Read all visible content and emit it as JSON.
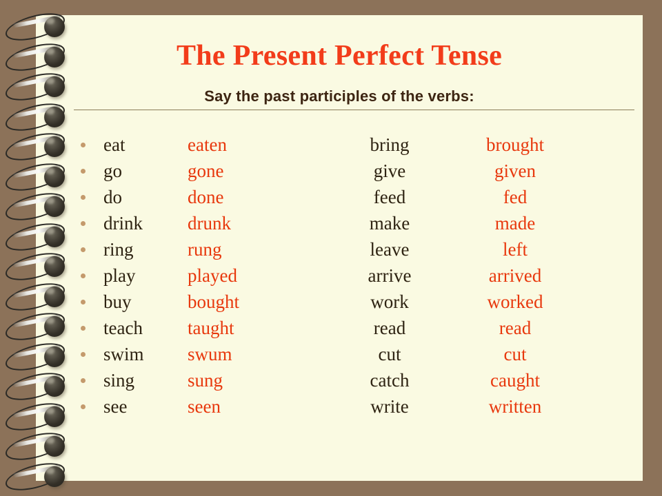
{
  "slide": {
    "title": "The Present Perfect Tense",
    "subtitle": "Say the past participles of the verbs:",
    "colors": {
      "background": "#8C7259",
      "paper": "#FAFAE2",
      "title": "#F23C1A",
      "subtitle": "#3D2512",
      "base_verb": "#2E2312",
      "participle": "#E8380D",
      "bullet": "#C49A6C",
      "rule": "#8A7D58"
    }
  },
  "verb_rows": [
    {
      "base_left": "eat",
      "participle_left": "eaten",
      "base_right": "bring",
      "participle_right": "brought"
    },
    {
      "base_left": "go",
      "participle_left": "gone",
      "base_right": "give",
      "participle_right": "given"
    },
    {
      "base_left": "do",
      "participle_left": "done",
      "base_right": "feed",
      "participle_right": "fed"
    },
    {
      "base_left": "drink",
      "participle_left": "drunk",
      "base_right": "make",
      "participle_right": "made"
    },
    {
      "base_left": "ring",
      "participle_left": "rung",
      "base_right": "leave",
      "participle_right": "left"
    },
    {
      "base_left": "play",
      "participle_left": "played",
      "base_right": "arrive",
      "participle_right": "arrived"
    },
    {
      "base_left": "buy",
      "participle_left": "bought",
      "base_right": "work",
      "participle_right": "worked"
    },
    {
      "base_left": "teach",
      "participle_left": "taught",
      "base_right": "read",
      "participle_right": "read"
    },
    {
      "base_left": "swim",
      "participle_left": "swum",
      "base_right": "cut",
      "participle_right": "cut"
    },
    {
      "base_left": "sing",
      "participle_left": "sung",
      "base_right": "catch",
      "participle_right": "caught"
    },
    {
      "base_left": "see",
      "participle_left": "seen",
      "base_right": "write",
      "participle_right": "written"
    }
  ],
  "binding": {
    "type": "spiral-wire-binding",
    "coil_count": 16
  }
}
